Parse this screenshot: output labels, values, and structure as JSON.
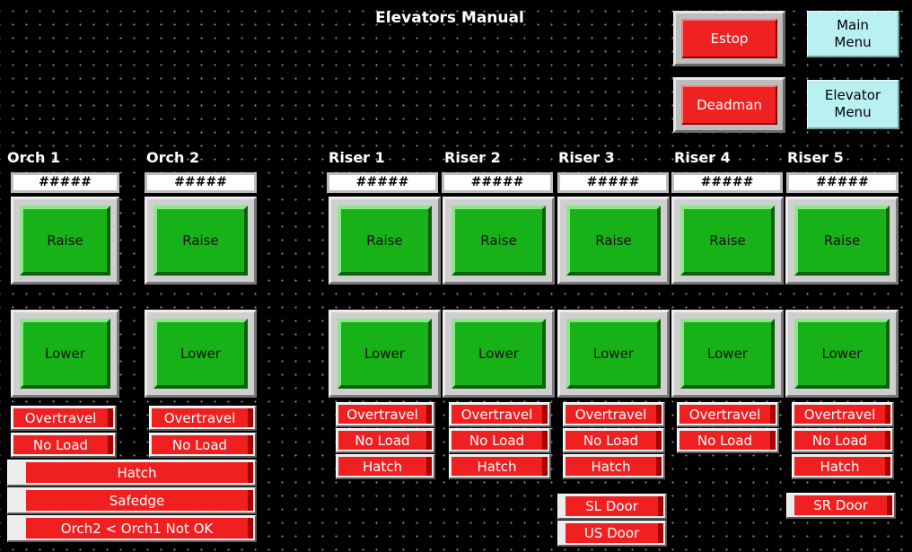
{
  "title": "Elevators Manual",
  "top_buttons": {
    "estop": "Estop",
    "deadman": "Deadman",
    "main_menu": "Main\nMenu",
    "elevator_menu": "Elevator\nMenu"
  },
  "raise_label": "Raise",
  "lower_label": "Lower",
  "columns": [
    {
      "name": "Orch 1",
      "readout": "#####"
    },
    {
      "name": "Orch 2",
      "readout": "#####"
    },
    {
      "name": "Riser 1",
      "readout": "#####"
    },
    {
      "name": "Riser 2",
      "readout": "#####"
    },
    {
      "name": "Riser 3",
      "readout": "#####"
    },
    {
      "name": "Riser 4",
      "readout": "#####"
    },
    {
      "name": "Riser 5",
      "readout": "#####"
    }
  ],
  "indicators": {
    "overtravel": "Overtravel",
    "no_load": "No Load",
    "hatch": "Hatch",
    "safedge": "Safedge",
    "orch_check": "Orch2 < Orch1 Not OK",
    "sl_door": "SL Door",
    "us_door": "US Door",
    "sr_door": "SR Door"
  },
  "colors": {
    "background": "#000000",
    "alarm_red": "#f02020",
    "raise_lower_green": "#17b217",
    "menu_cyan": "#b9f0f2"
  }
}
